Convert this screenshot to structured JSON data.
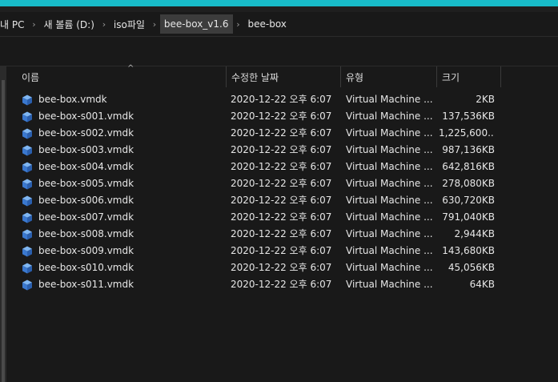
{
  "breadcrumb": {
    "items": [
      {
        "label": "내 PC"
      },
      {
        "label": "새 볼륨 (D:)"
      },
      {
        "label": "iso파일"
      },
      {
        "label": "bee-box_v1.6"
      },
      {
        "label": "bee-box"
      }
    ],
    "separator": "›"
  },
  "columns": {
    "name": "이름",
    "date": "수정한 날짜",
    "type": "유형",
    "size": "크기",
    "sort_indicator": "^"
  },
  "files": [
    {
      "name": "bee-box.vmdk",
      "date": "2020-12-22 오후 6:07",
      "type": "Virtual Machine ...",
      "size": "2KB",
      "icon": "vmdk-file-icon"
    },
    {
      "name": "bee-box-s001.vmdk",
      "date": "2020-12-22 오후 6:07",
      "type": "Virtual Machine ...",
      "size": "137,536KB",
      "icon": "vmdk-file-icon"
    },
    {
      "name": "bee-box-s002.vmdk",
      "date": "2020-12-22 오후 6:07",
      "type": "Virtual Machine ...",
      "size": "1,225,600...",
      "icon": "vmdk-file-icon"
    },
    {
      "name": "bee-box-s003.vmdk",
      "date": "2020-12-22 오후 6:07",
      "type": "Virtual Machine ...",
      "size": "987,136KB",
      "icon": "vmdk-file-icon"
    },
    {
      "name": "bee-box-s004.vmdk",
      "date": "2020-12-22 오후 6:07",
      "type": "Virtual Machine ...",
      "size": "642,816KB",
      "icon": "vmdk-file-icon"
    },
    {
      "name": "bee-box-s005.vmdk",
      "date": "2020-12-22 오후 6:07",
      "type": "Virtual Machine ...",
      "size": "278,080KB",
      "icon": "vmdk-file-icon"
    },
    {
      "name": "bee-box-s006.vmdk",
      "date": "2020-12-22 오후 6:07",
      "type": "Virtual Machine ...",
      "size": "630,720KB",
      "icon": "vmdk-file-icon"
    },
    {
      "name": "bee-box-s007.vmdk",
      "date": "2020-12-22 오후 6:07",
      "type": "Virtual Machine ...",
      "size": "791,040KB",
      "icon": "vmdk-file-icon"
    },
    {
      "name": "bee-box-s008.vmdk",
      "date": "2020-12-22 오후 6:07",
      "type": "Virtual Machine ...",
      "size": "2,944KB",
      "icon": "vmdk-file-icon"
    },
    {
      "name": "bee-box-s009.vmdk",
      "date": "2020-12-22 오후 6:07",
      "type": "Virtual Machine ...",
      "size": "143,680KB",
      "icon": "vmdk-file-icon"
    },
    {
      "name": "bee-box-s010.vmdk",
      "date": "2020-12-22 오후 6:07",
      "type": "Virtual Machine ...",
      "size": "45,056KB",
      "icon": "vmdk-file-icon"
    },
    {
      "name": "bee-box-s011.vmdk",
      "date": "2020-12-22 오후 6:07",
      "type": "Virtual Machine ...",
      "size": "64KB",
      "icon": "vmdk-file-icon"
    }
  ],
  "colors": {
    "accent": "#18bcc9",
    "background": "#191919",
    "text": "#e6e6e6",
    "icon_blue": "#4a8fe0"
  }
}
